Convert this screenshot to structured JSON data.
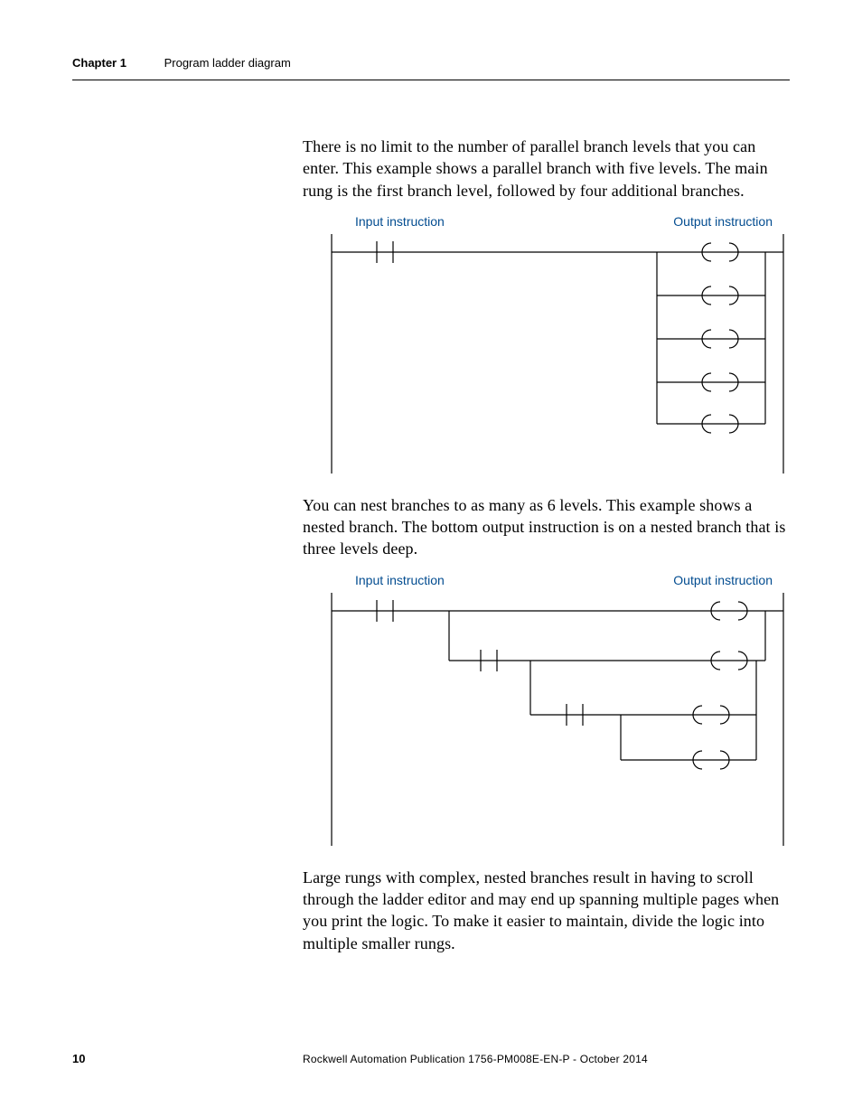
{
  "header": {
    "chapter": "Chapter 1",
    "section": "Program ladder diagram"
  },
  "paragraphs": {
    "p1": "There is no limit to the number of parallel branch levels that you can enter. This example shows a parallel branch with five levels. The main rung is the first branch level, followed by four additional branches.",
    "p2": "You can nest branches to as many as 6 levels. This example shows a nested branch. The bottom output instruction is on a nested branch that is three levels deep.",
    "p3": "Large rungs with complex, nested branches result in having to scroll through the ladder editor and may end up spanning multiple pages when you print the logic. To make it easier to maintain, divide the logic into multiple smaller rungs."
  },
  "diagram_labels": {
    "input": "Input instruction",
    "output": "Output instruction"
  },
  "footer": {
    "page_number": "10",
    "publication": "Rockwell Automation Publication 1756-PM008E-EN-P - October 2014"
  }
}
